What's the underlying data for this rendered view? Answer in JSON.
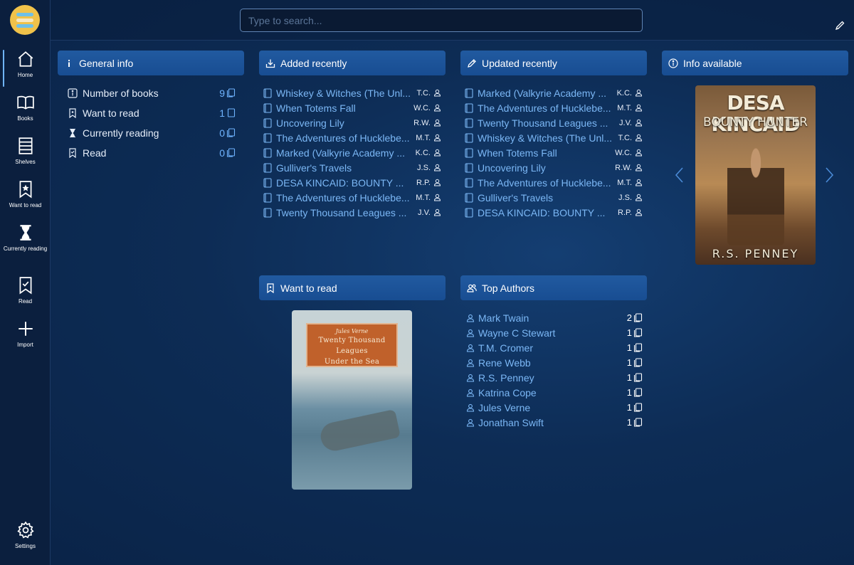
{
  "nav": {
    "items": [
      {
        "label": "Home",
        "icon": "home-icon"
      },
      {
        "label": "Books",
        "icon": "open-book-icon"
      },
      {
        "label": "Shelves",
        "icon": "shelves-icon"
      },
      {
        "label": "Want to read",
        "icon": "bookmark-star-icon"
      },
      {
        "label": "Currently reading",
        "icon": "hourglass-icon"
      },
      {
        "label": "Read",
        "icon": "bookmark-check-icon"
      },
      {
        "label": "Import",
        "icon": "plus-icon"
      },
      {
        "label": "Settings",
        "icon": "gear-icon"
      }
    ],
    "active": "Home"
  },
  "search": {
    "placeholder": "Type to search..."
  },
  "panels": {
    "general_info": "General info",
    "added_recently": "Added recently",
    "updated_recently": "Updated recently",
    "info_available": "Info available",
    "want_to_read": "Want to read",
    "top_authors": "Top Authors"
  },
  "general_info": [
    {
      "label": "Number of books",
      "count": "9",
      "icon": "info-icon"
    },
    {
      "label": "Want to read",
      "count": "1",
      "icon": "bookmark-star-icon"
    },
    {
      "label": "Currently reading",
      "count": "0",
      "icon": "hourglass-icon"
    },
    {
      "label": "Read",
      "count": "0",
      "icon": "bookmark-check-icon"
    }
  ],
  "added_recently": [
    {
      "title": "Whiskey & Witches (The Unl...",
      "author": "T.C."
    },
    {
      "title": "When Totems Fall",
      "author": "W.C."
    },
    {
      "title": "Uncovering Lily",
      "author": "R.W."
    },
    {
      "title": "The Adventures of Hucklebe...",
      "author": "M.T."
    },
    {
      "title": "Marked (Valkyrie Academy ...",
      "author": "K.C."
    },
    {
      "title": "Gulliver's Travels",
      "author": "J.S."
    },
    {
      "title": "DESA KINCAID: BOUNTY ...",
      "author": "R.P."
    },
    {
      "title": "The Adventures of Hucklebe...",
      "author": "M.T."
    },
    {
      "title": "Twenty Thousand Leagues ...",
      "author": "J.V."
    }
  ],
  "updated_recently": [
    {
      "title": "Marked (Valkyrie Academy ...",
      "author": "K.C."
    },
    {
      "title": "The Adventures of Hucklebe...",
      "author": "M.T."
    },
    {
      "title": "Twenty Thousand Leagues ...",
      "author": "J.V."
    },
    {
      "title": "Whiskey & Witches (The Unl...",
      "author": "T.C."
    },
    {
      "title": "When Totems Fall",
      "author": "W.C."
    },
    {
      "title": "Uncovering Lily",
      "author": "R.W."
    },
    {
      "title": "The Adventures of Hucklebe...",
      "author": "M.T."
    },
    {
      "title": "Gulliver's Travels",
      "author": "J.S."
    },
    {
      "title": "DESA KINCAID: BOUNTY ...",
      "author": "R.P."
    }
  ],
  "top_authors": [
    {
      "name": "Mark Twain",
      "count": "2"
    },
    {
      "name": "Wayne C Stewart",
      "count": "1"
    },
    {
      "name": "T.M. Cromer",
      "count": "1"
    },
    {
      "name": "Rene Webb",
      "count": "1"
    },
    {
      "name": "R.S. Penney",
      "count": "1"
    },
    {
      "name": "Katrina Cope",
      "count": "1"
    },
    {
      "name": "Jules Verne",
      "count": "1"
    },
    {
      "name": "Jonathan Swift",
      "count": "1"
    }
  ],
  "covers": {
    "info_available": {
      "title": "DESA KINCAID",
      "subtitle": "BOUNTY HUNTER",
      "author": "R.S. PENNEY"
    },
    "want_to_read": {
      "author": "Jules Verne",
      "title_line1": "Twenty Thousand",
      "title_line2": "Leagues",
      "title_line3": "Under the Sea"
    }
  },
  "colors": {
    "accent": "#7bb7f5",
    "panel_header": "#1d539a",
    "sidebar_bg": "#0b1f3e"
  }
}
